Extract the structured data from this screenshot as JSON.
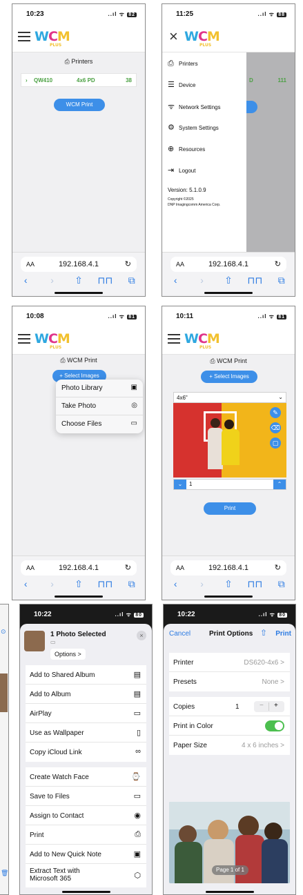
{
  "brand": {
    "logo_w": "W",
    "logo_c": "C",
    "logo_m": "M",
    "logo_plus": "PLUS"
  },
  "safari": {
    "aa": "AA",
    "url": "192.168.4.1",
    "reload": "↻",
    "back": "‹",
    "forward": "›",
    "share": "⇧",
    "bookmarks": "⊓⊓",
    "tabs": "⧉"
  },
  "screen1": {
    "time": "10:23",
    "signal": "..ıl ᯤ",
    "battery": "82",
    "section_title": "Printers",
    "printer": {
      "name": "QW410",
      "media": "4x6 PD",
      "count": "38"
    },
    "button": "WCM Print"
  },
  "screen2": {
    "time": "11:25",
    "signal": "..ıl ᯤ",
    "battery": "88",
    "behind_media": "D",
    "behind_count": "111",
    "menu": [
      "Printers",
      "Device",
      "Network Settings",
      "System Settings",
      "Resources",
      "Logout"
    ],
    "version": "Version: 5.1.0.9",
    "copyright_1": "Copyright ©2025",
    "copyright_2": "DNP Imagingcomm America Corp."
  },
  "screen3": {
    "time": "10:08",
    "signal": "..ıl ᯤ",
    "battery": "81",
    "section_title": "WCM Print",
    "button": "+ Select Images",
    "popup": [
      "Photo Library",
      "Take Photo",
      "Choose Files"
    ]
  },
  "screen4": {
    "time": "10:11",
    "signal": "..ıl ᯤ",
    "battery": "81",
    "section_title": "WCM Print",
    "button": "+ Select Images",
    "size_select": "4x6\"",
    "copies": "1",
    "print_button": "Print"
  },
  "screen5": {
    "time": "10:22",
    "signal": "..ıl ᯤ",
    "battery": "80",
    "title": "1 Photo Selected",
    "options": "Options >",
    "actions": [
      "Add to Shared Album",
      "Add to Album",
      "AirPlay",
      "Use as Wallpaper",
      "Copy iCloud Link",
      "Create Watch Face",
      "Save to Files",
      "Assign to Contact",
      "Print",
      "Add to New Quick Note",
      "Extract Text with Microsoft 365"
    ]
  },
  "screen6": {
    "time": "10:22",
    "signal": "..ıl ᯤ",
    "battery": "80",
    "cancel": "Cancel",
    "title": "Print Options",
    "print": "Print",
    "printer_label": "Printer",
    "printer_value": "DS620-4x6 >",
    "presets_label": "Presets",
    "presets_value": "None >",
    "copies_label": "Copies",
    "copies_value": "1",
    "color_label": "Print in Color",
    "paper_label": "Paper Size",
    "paper_value": "4 x 6 inches >",
    "page_indicator": "Page 1 of 1"
  }
}
